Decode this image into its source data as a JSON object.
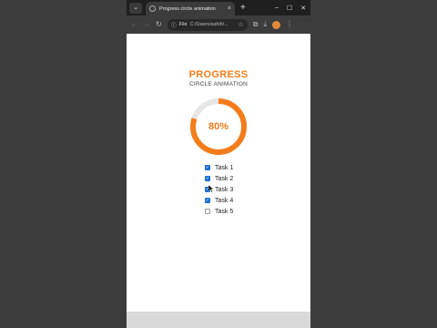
{
  "browser": {
    "tab_menu_icon": "chevron-down-icon",
    "tab_title": "Progress circle animation",
    "tab_close": "×",
    "new_tab": "+",
    "window_controls": {
      "minimize": "–",
      "maximize": "☐",
      "close": "✕"
    },
    "omnibox": {
      "scheme_label": "File",
      "url": "C:/Users/ashih/..."
    }
  },
  "page": {
    "title": "PROGRESS",
    "subtitle": "CIRCLE ANIMATION",
    "progress_percent_label": "80%",
    "progress_value": 0.8,
    "tasks": [
      {
        "label": "Task 1",
        "checked": true
      },
      {
        "label": "Task 2",
        "checked": true
      },
      {
        "label": "Task 3",
        "checked": true
      },
      {
        "label": "Task 4",
        "checked": true
      },
      {
        "label": "Task 5",
        "checked": false
      }
    ]
  },
  "colors": {
    "accent": "#f47c1a",
    "ring_track": "#e6e6e6",
    "checkbox": "#1a6fd1"
  }
}
